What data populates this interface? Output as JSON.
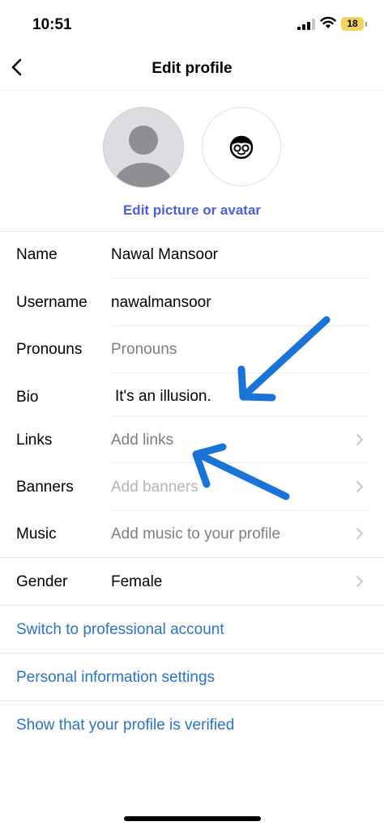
{
  "status_bar": {
    "time": "10:51",
    "battery": "18"
  },
  "header": {
    "title": "Edit profile"
  },
  "avatar": {
    "edit_link": "Edit picture or avatar"
  },
  "fields": [
    {
      "label": "Name",
      "value": "Nawal Mansoor",
      "is_placeholder": false
    },
    {
      "label": "Username",
      "value": "nawalmansoor",
      "is_placeholder": false
    },
    {
      "label": "Pronouns",
      "value": "Pronouns",
      "is_placeholder": true
    },
    {
      "label": "Bio",
      "value": "It's an illusion.",
      "is_placeholder": false
    },
    {
      "label": "Links",
      "value": "Add links",
      "is_placeholder": true
    },
    {
      "label": "Banners",
      "value": "Add banners",
      "is_placeholder": true
    },
    {
      "label": "Music",
      "value": "Add music to your profile",
      "is_placeholder": true
    },
    {
      "label": "Gender",
      "value": "Female",
      "is_placeholder": false
    }
  ],
  "links": {
    "professional": "Switch to professional account",
    "personal_info": "Personal information settings",
    "verified": "Show that your profile is verified"
  },
  "colors": {
    "link_blue": "#2a74c5",
    "edit_link": "#4a5fd9",
    "annotation_arrow": "#1a73d6"
  }
}
